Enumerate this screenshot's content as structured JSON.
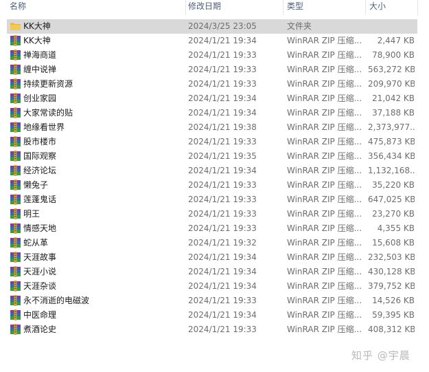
{
  "columns": {
    "name": "名称",
    "date": "修改日期",
    "type": "类型",
    "size": "大小"
  },
  "files": [
    {
      "name": "KK大神",
      "date": "2024/3/25 23:05",
      "type": "文件夹",
      "size": "",
      "icon": "folder-icon",
      "selected": true
    },
    {
      "name": "KK大神",
      "date": "2024/1/21 19:34",
      "type": "WinRAR ZIP 压缩...",
      "size": "2,447 KB",
      "icon": "winrar-zip-icon"
    },
    {
      "name": "禅海商道",
      "date": "2024/1/21 19:33",
      "type": "WinRAR ZIP 压缩...",
      "size": "78,900 KB",
      "icon": "winrar-zip-icon"
    },
    {
      "name": "缠中说禅",
      "date": "2024/1/21 19:33",
      "type": "WinRAR ZIP 压缩...",
      "size": "563,272 KB",
      "icon": "winrar-zip-icon"
    },
    {
      "name": "持续更新资源",
      "date": "2024/1/21 19:33",
      "type": "WinRAR ZIP 压缩...",
      "size": "209,970 KB",
      "icon": "winrar-zip-icon"
    },
    {
      "name": "创业家园",
      "date": "2024/1/21 19:34",
      "type": "WinRAR ZIP 压缩...",
      "size": "21,042 KB",
      "icon": "winrar-zip-icon"
    },
    {
      "name": "大家常读的贴",
      "date": "2024/1/21 19:34",
      "type": "WinRAR ZIP 压缩...",
      "size": "37,188 KB",
      "icon": "winrar-zip-icon"
    },
    {
      "name": "地缘看世界",
      "date": "2024/1/21 19:38",
      "type": "WinRAR ZIP 压缩...",
      "size": "2,373,977...",
      "icon": "winrar-zip-icon"
    },
    {
      "name": "股市楼市",
      "date": "2024/1/21 19:33",
      "type": "WinRAR ZIP 压缩...",
      "size": "475,873 KB",
      "icon": "winrar-zip-icon"
    },
    {
      "name": "国际观察",
      "date": "2024/1/21 19:35",
      "type": "WinRAR ZIP 压缩...",
      "size": "356,434 KB",
      "icon": "winrar-zip-icon"
    },
    {
      "name": "经济论坛",
      "date": "2024/1/21 19:34",
      "type": "WinRAR ZIP 压缩...",
      "size": "1,132,168...",
      "icon": "winrar-zip-icon"
    },
    {
      "name": "懒兔子",
      "date": "2024/1/21 19:33",
      "type": "WinRAR ZIP 压缩...",
      "size": "35,220 KB",
      "icon": "winrar-zip-icon"
    },
    {
      "name": "莲蓬鬼话",
      "date": "2024/1/21 19:33",
      "type": "WinRAR ZIP 压缩...",
      "size": "647,025 KB",
      "icon": "winrar-zip-icon"
    },
    {
      "name": "明王",
      "date": "2024/1/21 19:33",
      "type": "WinRAR ZIP 压缩...",
      "size": "23,270 KB",
      "icon": "winrar-zip-icon"
    },
    {
      "name": "情感天地",
      "date": "2024/1/21 19:33",
      "type": "WinRAR ZIP 压缩...",
      "size": "4,355 KB",
      "icon": "winrar-zip-icon"
    },
    {
      "name": "蛇从革",
      "date": "2024/1/21 19:32",
      "type": "WinRAR ZIP 压缩...",
      "size": "15,608 KB",
      "icon": "winrar-zip-icon"
    },
    {
      "name": "天涯故事",
      "date": "2024/1/21 19:34",
      "type": "WinRAR ZIP 压缩...",
      "size": "232,503 KB",
      "icon": "winrar-zip-icon"
    },
    {
      "name": "天涯小说",
      "date": "2024/1/21 19:34",
      "type": "WinRAR ZIP 压缩...",
      "size": "430,128 KB",
      "icon": "winrar-zip-icon"
    },
    {
      "name": "天涯杂谈",
      "date": "2024/1/21 19:34",
      "type": "WinRAR ZIP 压缩...",
      "size": "379,752 KB",
      "icon": "winrar-zip-icon"
    },
    {
      "name": "永不消逝的电磁波",
      "date": "2024/1/21 19:33",
      "type": "WinRAR ZIP 压缩...",
      "size": "14,526 KB",
      "icon": "winrar-zip-icon"
    },
    {
      "name": "中医命理",
      "date": "2024/1/21 19:34",
      "type": "WinRAR ZIP 压缩...",
      "size": "59,395 KB",
      "icon": "winrar-zip-icon"
    },
    {
      "name": "煮酒论史",
      "date": "2024/1/21 19:33",
      "type": "WinRAR ZIP 压缩...",
      "size": "408,312 KB",
      "icon": "winrar-zip-icon"
    }
  ],
  "watermark": "知乎 @宇晨",
  "colors": {
    "selected_row": "#d9d9d9",
    "header_text": "#4c607a",
    "folder": "#f3c855",
    "archive": "#7b3f98"
  }
}
